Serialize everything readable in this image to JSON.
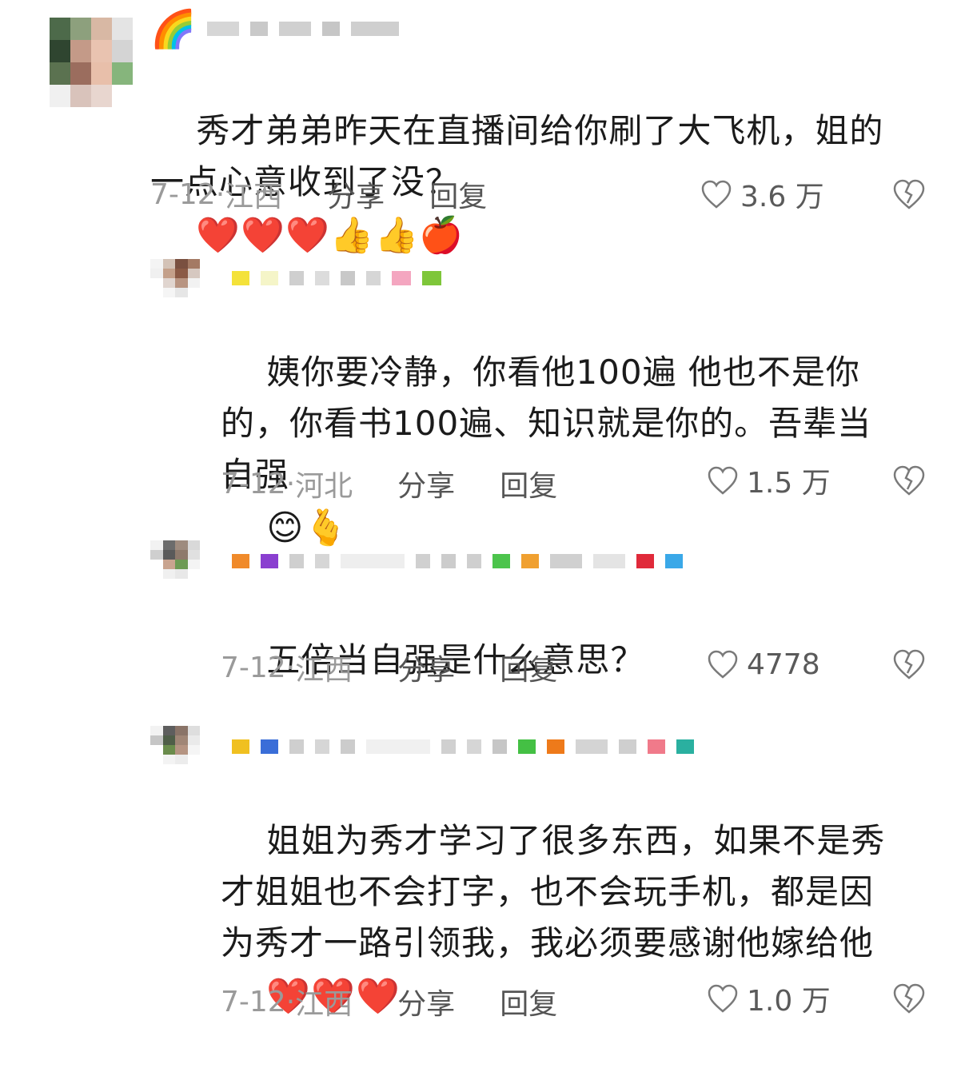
{
  "comments": [
    {
      "text": "秀才弟弟昨天在直播间给你刷了大飞机，姐的一点心意收到了没？",
      "emojis": [
        "❤️",
        "❤️",
        "❤️",
        "👍",
        "👍",
        "🍎"
      ],
      "date": "7-12",
      "location": "江西",
      "share_label": "分享",
      "reply_label": "回复",
      "likes": "3.6 万",
      "badge": "🌈"
    },
    {
      "text": "姨你要冷静，你看他100遍 他也不是你的，你看书100遍、知识就是你的。吾辈当自强",
      "emojis": [
        "😊",
        "🫰"
      ],
      "date": "7-12",
      "location": "河北",
      "share_label": "分享",
      "reply_label": "回复",
      "likes": "1.5 万"
    },
    {
      "text": "五倍当自强是什么意思？",
      "emojis": [],
      "date": "7-12",
      "location": "江西",
      "share_label": "分享",
      "reply_label": "回复",
      "likes": "4778"
    },
    {
      "text": "姐姐为秀才学习了很多东西，如果不是秀才姐姐也不会打字，也不会玩手机，都是因为秀才一路引领我，我必须要感谢他嫁给他",
      "emojis": [
        "❤️",
        "❤️",
        "❤️"
      ],
      "date": "7-12",
      "location": "江西",
      "share_label": "分享",
      "reply_label": "回复",
      "likes": "1.0 万"
    }
  ],
  "colors": {
    "heart": "#e8303c",
    "meta_gray": "#9a9a9a",
    "icon_gray": "#7a7a7a"
  }
}
